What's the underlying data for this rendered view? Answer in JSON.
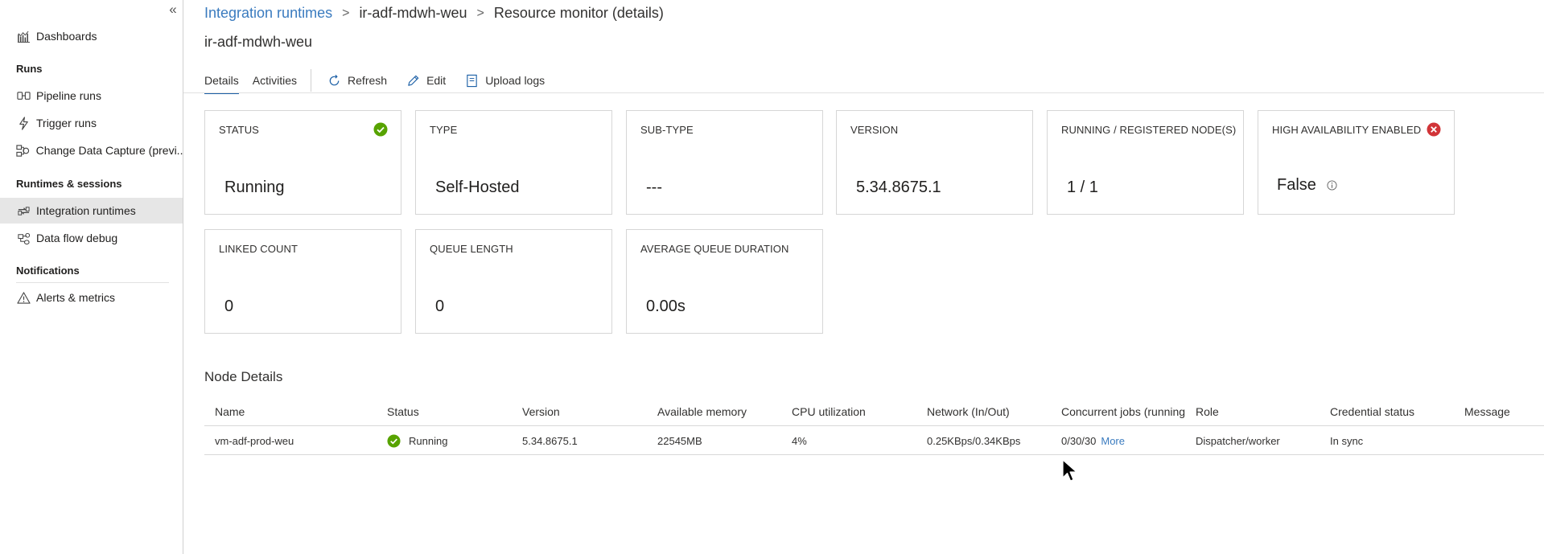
{
  "sidebar": {
    "collapse_glyph": "«",
    "items": [
      {
        "label": "Dashboards",
        "icon": "dashboard-icon"
      },
      {
        "label": "Pipeline runs",
        "icon": "pipeline-icon"
      },
      {
        "label": "Trigger runs",
        "icon": "trigger-icon"
      },
      {
        "label": "Change Data Capture (previ...",
        "icon": "cdc-icon"
      },
      {
        "label": "Integration runtimes",
        "icon": "integration-runtime-icon",
        "active": true
      },
      {
        "label": "Data flow debug",
        "icon": "dataflow-debug-icon"
      },
      {
        "label": "Alerts & metrics",
        "icon": "alert-icon"
      }
    ],
    "headers": {
      "runs": "Runs",
      "runtimes": "Runtimes & sessions",
      "notifications": "Notifications"
    }
  },
  "breadcrumb": {
    "root": "Integration runtimes",
    "sep": ">",
    "item": "ir-adf-mdwh-weu",
    "current": "Resource monitor (details)"
  },
  "page_title": "ir-adf-mdwh-weu",
  "toolbar": {
    "tab_details": "Details",
    "tab_activities": "Activities",
    "refresh": "Refresh",
    "edit": "Edit",
    "upload_logs": "Upload logs"
  },
  "cards": {
    "status": {
      "label": "STATUS",
      "value": "Running"
    },
    "type": {
      "label": "TYPE",
      "value": "Self-Hosted"
    },
    "subtype": {
      "label": "SUB-TYPE",
      "value": "---"
    },
    "version": {
      "label": "VERSION",
      "value": "5.34.8675.1"
    },
    "nodes": {
      "label": "RUNNING / REGISTERED NODE(S)",
      "value": "1 / 1"
    },
    "ha": {
      "label": "HIGH AVAILABILITY ENABLED",
      "value": "False"
    },
    "linked": {
      "label": "LINKED COUNT",
      "value": "0"
    },
    "queue": {
      "label": "QUEUE LENGTH",
      "value": "0"
    },
    "avgqueue": {
      "label": "AVERAGE QUEUE DURATION",
      "value": "0.00s"
    }
  },
  "node_details": {
    "title": "Node Details",
    "columns": [
      "Name",
      "Status",
      "Version",
      "Available memory",
      "CPU utilization",
      "Network (In/Out)",
      "Concurrent jobs (running",
      "Role",
      "Credential status",
      "Message"
    ],
    "rows": [
      {
        "name": "vm-adf-prod-weu",
        "status": "Running",
        "version": "5.34.8675.1",
        "memory": "22545MB",
        "cpu": "4%",
        "network": "0.25KBps/0.34KBps",
        "jobs": "0/30/30",
        "jobs_link": "More",
        "role": "Dispatcher/worker",
        "credential": "In sync",
        "message": ""
      }
    ]
  },
  "colors": {
    "accent": "#3a7bbf",
    "success": "#57a300",
    "error": "#d13438"
  }
}
